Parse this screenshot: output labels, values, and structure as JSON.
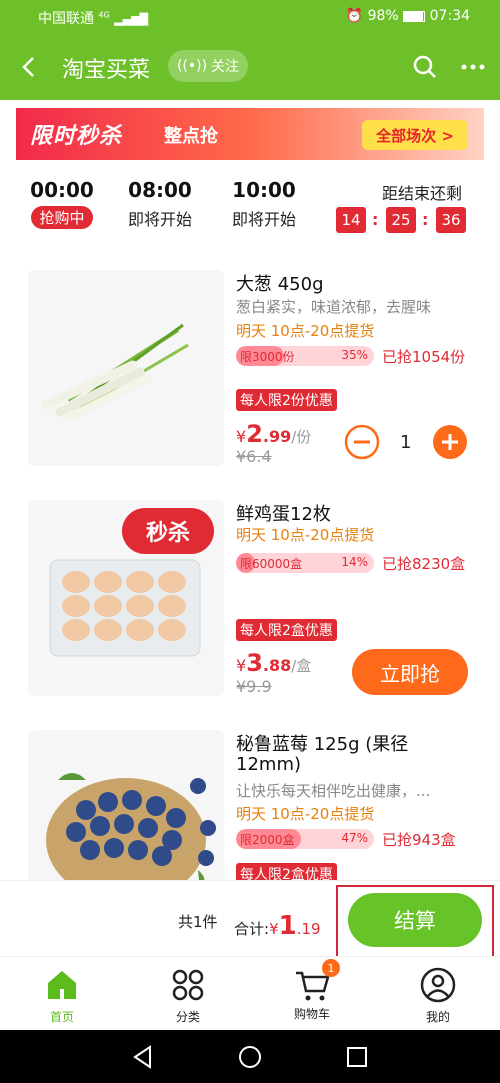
{
  "status": {
    "carrier": "中国联通",
    "net": "4G",
    "battery": "98%",
    "time": "07:34"
  },
  "header": {
    "title": "淘宝买菜",
    "follow_label": "关注"
  },
  "banner": {
    "logo": "限时秒杀",
    "subtitle": "整点抢",
    "all_sessions": "全部场次 >"
  },
  "sessions": [
    {
      "time": "00:00",
      "status": "抢购中",
      "active": true
    },
    {
      "time": "08:00",
      "status": "即将开始",
      "active": false
    },
    {
      "time": "10:00",
      "status": "即将开始",
      "active": false
    }
  ],
  "countdown": {
    "label": "距结束还剩",
    "h": "14",
    "m": "25",
    "s": "36"
  },
  "products": [
    {
      "name": "大葱 450g",
      "desc": "葱白紧实，味道浓郁，去腥味",
      "delivery": "明天 10点-20点提货",
      "limit": "限3000份",
      "progress_pct": 35,
      "progress_label": "35%",
      "sold": "已抢1054份",
      "promo": "每人限2份优惠",
      "price_int": "2",
      "price_dec": ".99",
      "unit": "/份",
      "orig": "¥6.4",
      "qty": "1"
    },
    {
      "name": "鲜鸡蛋12枚",
      "delivery": "明天 10点-20点提货",
      "limit": "限60000盒",
      "progress_pct": 14,
      "progress_label": "14%",
      "sold": "已抢8230盒",
      "promo": "每人限2盒优惠",
      "price_int": "3",
      "price_dec": ".88",
      "unit": "/盒",
      "orig": "¥9.9",
      "badge": "秒杀",
      "button": "立即抢"
    },
    {
      "name_line1": "秘鲁蓝莓 125g (果径",
      "name_line2": "12mm)",
      "desc": "让快乐每天相伴吃出健康，...",
      "delivery": "明天 10点-20点提货",
      "limit": "限2000盒",
      "progress_pct": 47,
      "progress_label": "47%",
      "sold": "已抢943盒",
      "promo": "每人限2盒优惠"
    }
  ],
  "currency": "¥",
  "checkout": {
    "count": "共1件",
    "total_label": "合计:",
    "total_currency": "¥",
    "total_int": "1",
    "total_dec": ".19",
    "button": "结算"
  },
  "tabs": [
    {
      "label": "首页",
      "active": true
    },
    {
      "label": "分类",
      "active": false
    },
    {
      "label": "购物车",
      "active": false,
      "badge": "1"
    },
    {
      "label": "我的",
      "active": false
    }
  ],
  "colors": {
    "brand": "#6ec02a",
    "red": "#e02a34",
    "orange": "#ff6a1a"
  }
}
